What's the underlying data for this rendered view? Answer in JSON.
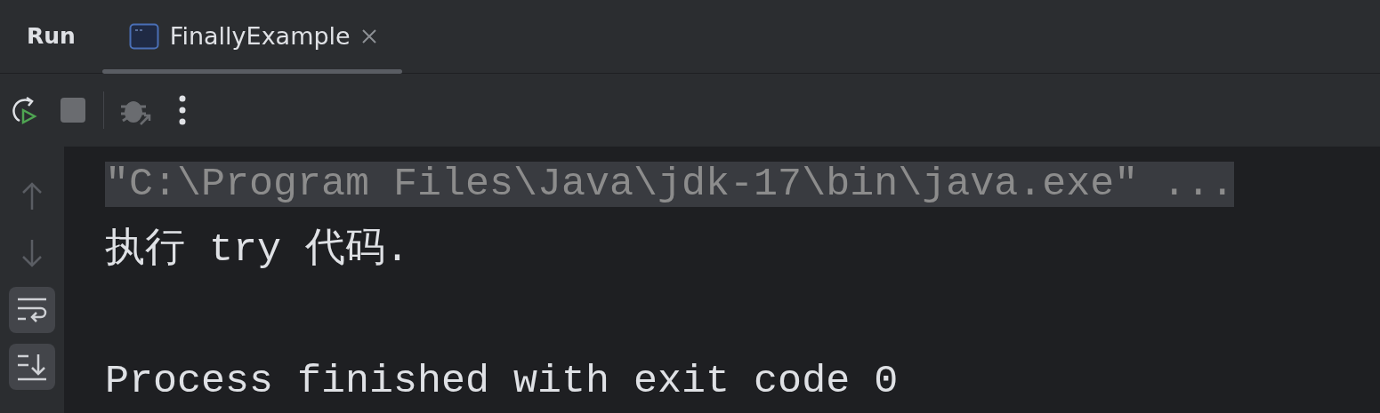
{
  "panel": {
    "title": "Run"
  },
  "tabs": [
    {
      "label": "FinallyExample",
      "selected": true
    }
  ],
  "toolbar": [
    {
      "kind": "rerun"
    },
    {
      "kind": "stop"
    },
    {
      "kind": "debug"
    },
    {
      "kind": "more"
    }
  ],
  "gutter": [
    {
      "kind": "up",
      "on": false
    },
    {
      "kind": "down",
      "on": false
    },
    {
      "kind": "wrap",
      "on": true
    },
    {
      "kind": "scroll",
      "on": true
    }
  ],
  "console": [
    {
      "text": "\"C:\\Program Files\\Java\\jdk-17\\bin\\java.exe\" ...",
      "kind": "command"
    },
    {
      "text": "执行 try 代码.",
      "kind": "output"
    },
    {
      "kind": "blank"
    },
    {
      "text": "Process finished with exit code 0",
      "kind": "output"
    }
  ]
}
